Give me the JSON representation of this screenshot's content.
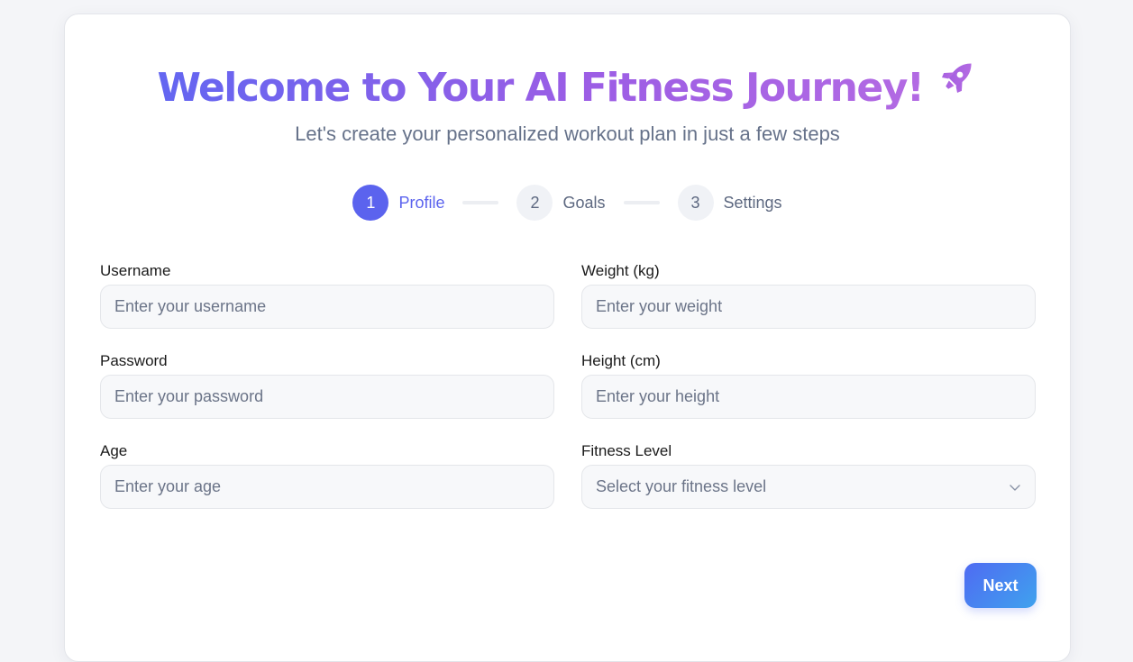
{
  "header": {
    "title": "Welcome to Your AI Fitness Journey!",
    "title_emoji": "rocket-icon",
    "subtitle": "Let's create your personalized workout plan in just a few steps"
  },
  "stepper": {
    "steps": [
      {
        "number": "1",
        "label": "Profile",
        "active": true
      },
      {
        "number": "2",
        "label": "Goals",
        "active": false
      },
      {
        "number": "3",
        "label": "Settings",
        "active": false
      }
    ]
  },
  "form": {
    "username": {
      "label": "Username",
      "placeholder": "Enter your username",
      "value": ""
    },
    "password": {
      "label": "Password",
      "placeholder": "Enter your password",
      "value": ""
    },
    "age": {
      "label": "Age",
      "placeholder": "Enter your age",
      "value": ""
    },
    "weight": {
      "label": "Weight (kg)",
      "placeholder": "Enter your weight",
      "value": ""
    },
    "height": {
      "label": "Height (cm)",
      "placeholder": "Enter your height",
      "value": ""
    },
    "fitness_level": {
      "label": "Fitness Level",
      "selected": "Select your fitness level"
    }
  },
  "actions": {
    "next_label": "Next"
  },
  "colors": {
    "accent": "#5b63ee",
    "title_gradient_start": "#6366f1",
    "title_gradient_end": "#b36ae3",
    "button_gradient_start": "#4f6bf2",
    "button_gradient_end": "#3fa2ee"
  }
}
